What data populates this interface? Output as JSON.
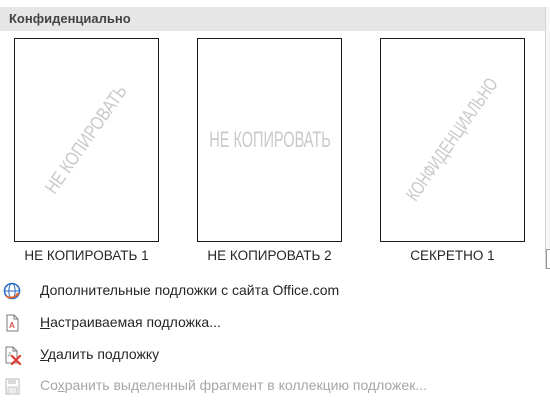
{
  "gallery": {
    "title": "Конфиденциально",
    "items": [
      {
        "watermark": "НЕ КОПИРОВАТЬ",
        "caption": "НЕ КОПИРОВАТЬ 1",
        "layout": "diagonal"
      },
      {
        "watermark": "НЕ КОПИРОВАТЬ",
        "caption": "НЕ КОПИРОВАТЬ 2",
        "layout": "horizontal"
      },
      {
        "watermark": "КОНФИДЕНЦИАЛЬНО",
        "caption": "СЕКРЕТНО 1",
        "layout": "diagonal"
      }
    ]
  },
  "menu": [
    {
      "mnemonic": "Д",
      "rest": "ополнительные подложки с сайта Office.com",
      "icon": "office-online-icon",
      "enabled": true
    },
    {
      "mnemonic": "Н",
      "rest": "астраиваемая подложка...",
      "icon": "custom-watermark-icon",
      "enabled": true
    },
    {
      "mnemonic": "У",
      "rest": "далить подложку",
      "icon": "remove-watermark-icon",
      "enabled": true
    },
    {
      "pre": "Со",
      "mnemonic": "х",
      "rest": "ранить выделенный фрагмент в коллекцию подложек...",
      "icon": "save-selection-icon",
      "enabled": false
    }
  ]
}
